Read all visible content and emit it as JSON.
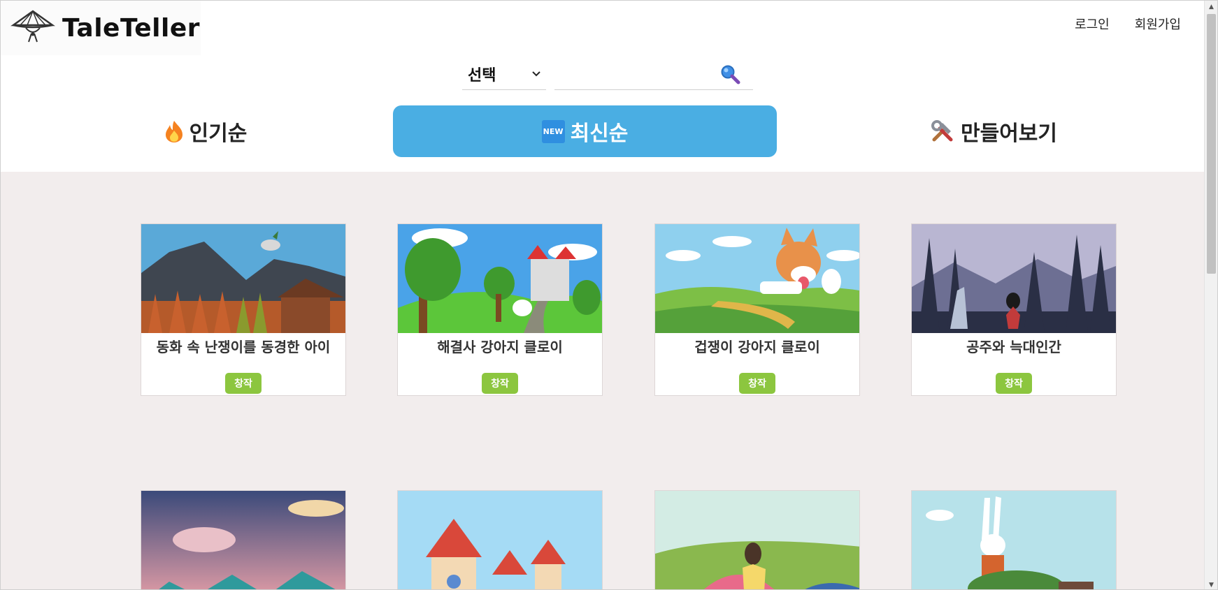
{
  "app": {
    "name": "TaleTeller"
  },
  "auth": {
    "login": "로그인",
    "signup": "회원가입"
  },
  "search": {
    "select_value": "선택",
    "placeholder": ""
  },
  "tabs": [
    {
      "label": "인기순",
      "icon": "fire-icon"
    },
    {
      "label": "최신순",
      "icon": "new-badge-icon",
      "badge": "NEW",
      "active": true
    },
    {
      "label": "만들어보기",
      "icon": "tools-icon"
    }
  ],
  "cards": [
    {
      "title": "동화 속 난쟁이를 동경한 아이",
      "button": "창작"
    },
    {
      "title": "해결사 강아지 클로이",
      "button": "창작"
    },
    {
      "title": "겁쟁이 강아지 클로이",
      "button": "창작"
    },
    {
      "title": "공주와 늑대인간",
      "button": "창작"
    }
  ],
  "colors": {
    "accent": "#4aaee3",
    "create_button": "#8cc63f",
    "content_bg": "#f2eded"
  }
}
